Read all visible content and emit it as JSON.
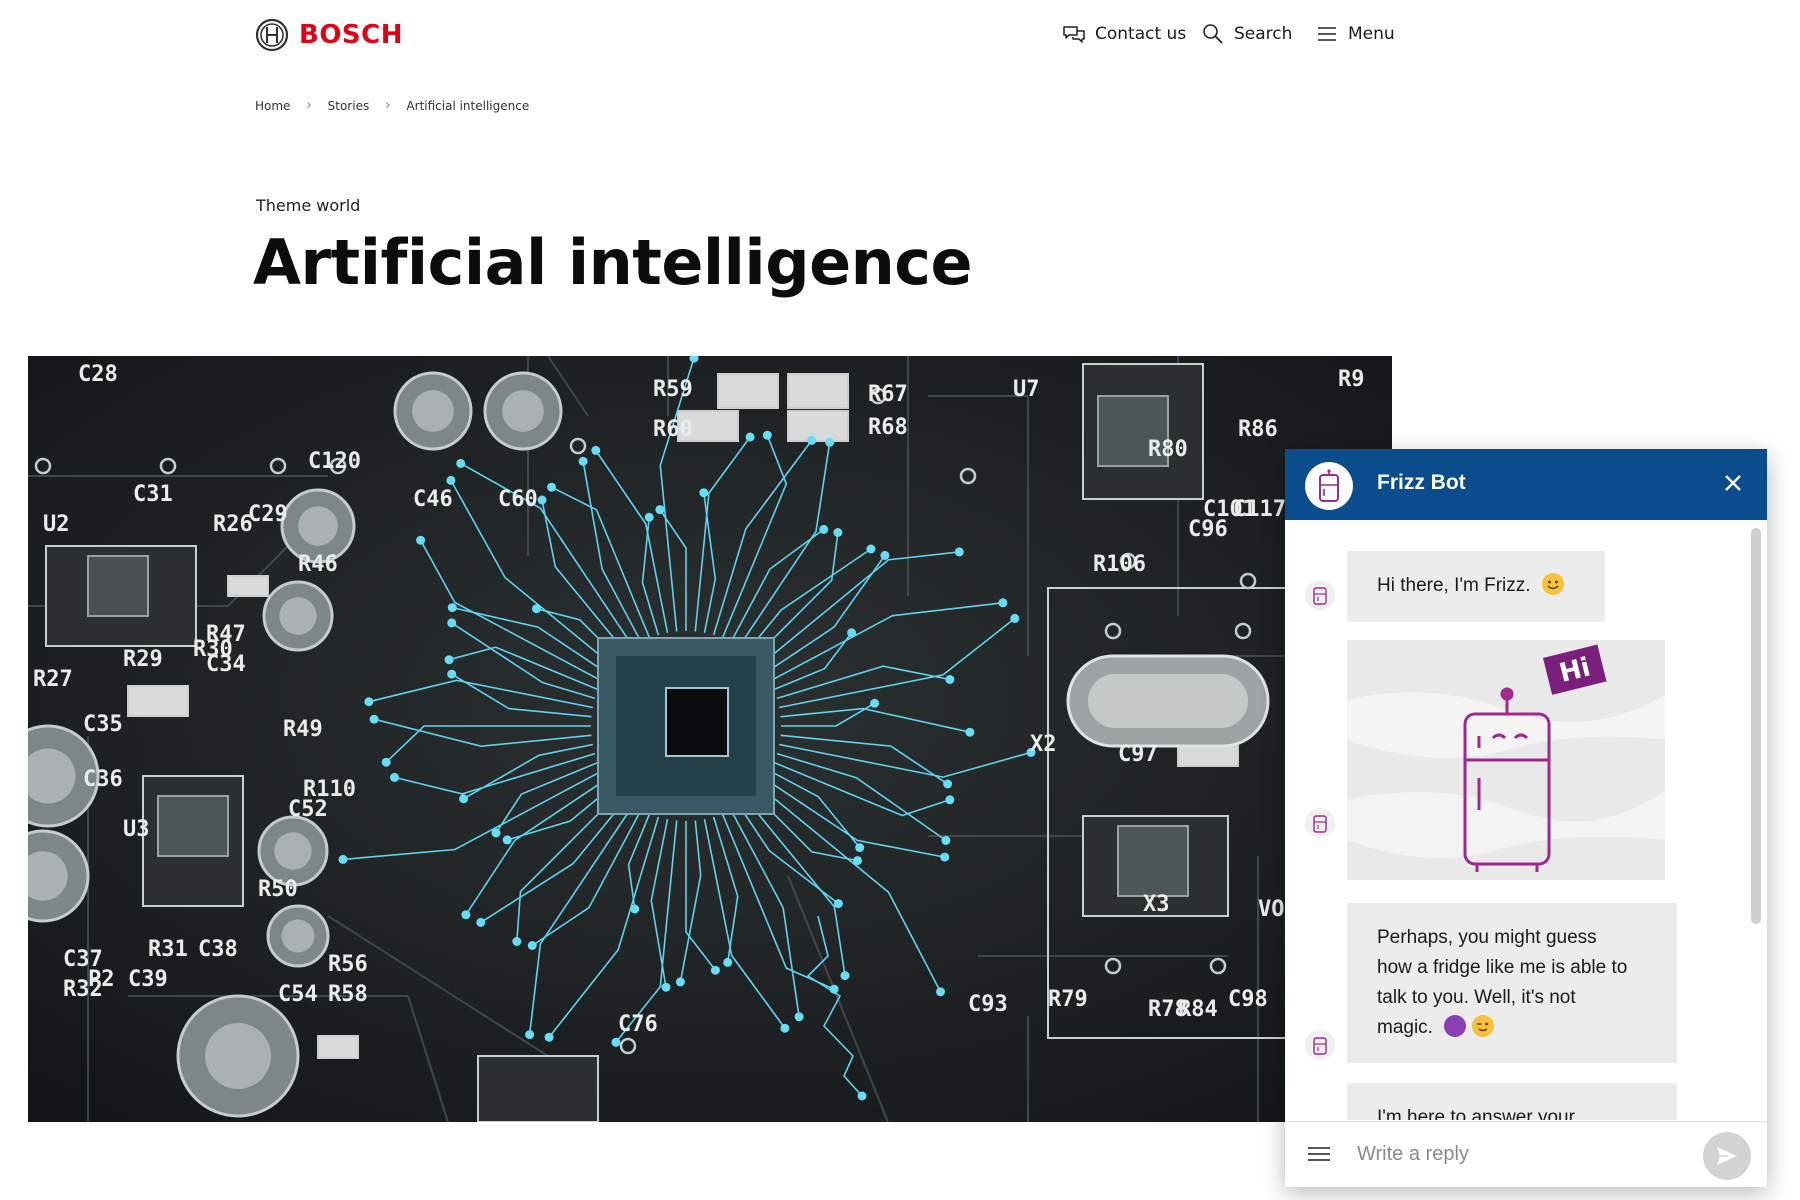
{
  "header": {
    "logo_text": "BOSCH",
    "brand_color": "#e20015",
    "nav": [
      {
        "label": "Contact us",
        "icon": "chat-bubbles-icon"
      },
      {
        "label": "Search",
        "icon": "search-icon"
      },
      {
        "label": "Menu",
        "icon": "hamburger-icon"
      }
    ]
  },
  "breadcrumb": [
    "Home",
    "Stories",
    "Artificial intelligence"
  ],
  "page": {
    "eyebrow": "Theme world",
    "title": "Artificial intelligence"
  },
  "hero": {
    "board_labels": [
      "C28",
      "C120",
      "C46",
      "C60",
      "R59",
      "R60",
      "R67",
      "R68",
      "U7",
      "R80",
      "R86",
      "R9",
      "C31",
      "R26",
      "C29",
      "U2",
      "R46",
      "R47",
      "C34",
      "R30",
      "R29",
      "R27",
      "C35",
      "C36",
      "R49",
      "R110",
      "U3",
      "C52",
      "R50",
      "C37",
      "R32",
      "R31",
      "C38",
      "P2",
      "C39",
      "R56",
      "R58",
      "C54",
      "C76",
      "R106",
      "X2",
      "C97",
      "X3",
      "C96",
      "C101",
      "C117",
      "C93",
      "R79",
      "R78",
      "R84",
      "C98",
      "VO"
    ],
    "circuit_color": "#5fd3ef"
  },
  "chat": {
    "title": "Frizz Bot",
    "header_color": "#0a4c8c",
    "messages": [
      {
        "type": "text",
        "text": "Hi there, I'm Frizz."
      },
      {
        "type": "image",
        "sign": "Hi"
      },
      {
        "type": "text",
        "lines": [
          "Perhaps, you might guess",
          "how a fridge like me is able to",
          "talk to you. Well, it's not",
          "magic."
        ]
      },
      {
        "type": "text",
        "text": "I'm here to answer your"
      }
    ],
    "input_placeholder": "Write a reply",
    "accent_purple": "#9b1b8f"
  }
}
